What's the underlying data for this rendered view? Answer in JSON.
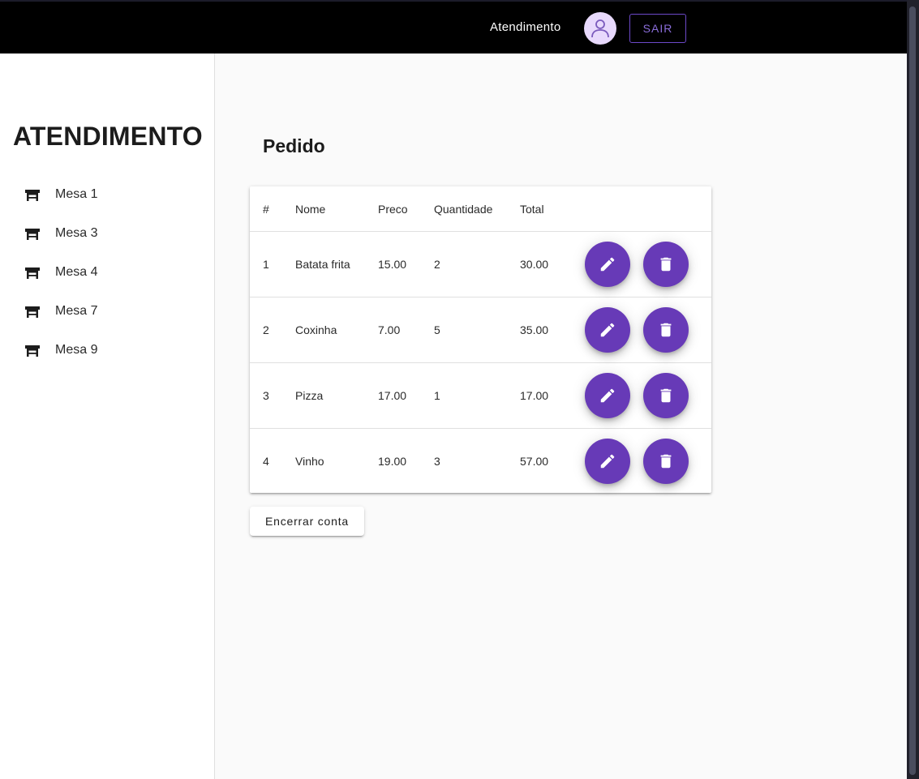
{
  "header": {
    "title": "Atendimento",
    "logout_label": "SAIR"
  },
  "sidebar": {
    "title": "ATENDIMENTO",
    "items": [
      {
        "label": "Mesa 1",
        "icon": "table-icon"
      },
      {
        "label": "Mesa 3",
        "icon": "table-icon"
      },
      {
        "label": "Mesa 4",
        "icon": "table-icon"
      },
      {
        "label": "Mesa 7",
        "icon": "table-icon"
      },
      {
        "label": "Mesa 9",
        "icon": "table-icon"
      }
    ]
  },
  "main": {
    "title": "Pedido",
    "table": {
      "headers": [
        "#",
        "Nome",
        "Preco",
        "Quantidade",
        "Total"
      ],
      "rows": [
        {
          "num": "1",
          "nome": "Batata frita",
          "preco": "15.00",
          "quantidade": "2",
          "total": "30.00"
        },
        {
          "num": "2",
          "nome": "Coxinha",
          "preco": "7.00",
          "quantidade": "5",
          "total": "35.00"
        },
        {
          "num": "3",
          "nome": "Pizza",
          "preco": "17.00",
          "quantidade": "1",
          "total": "17.00"
        },
        {
          "num": "4",
          "nome": "Vinho",
          "preco": "19.00",
          "quantidade": "3",
          "total": "57.00"
        }
      ]
    },
    "close_account_label": "Encerrar conta"
  },
  "colors": {
    "accent": "#673ab7",
    "topbar": "#000000",
    "avatar_bg": "#e8d9fc"
  }
}
